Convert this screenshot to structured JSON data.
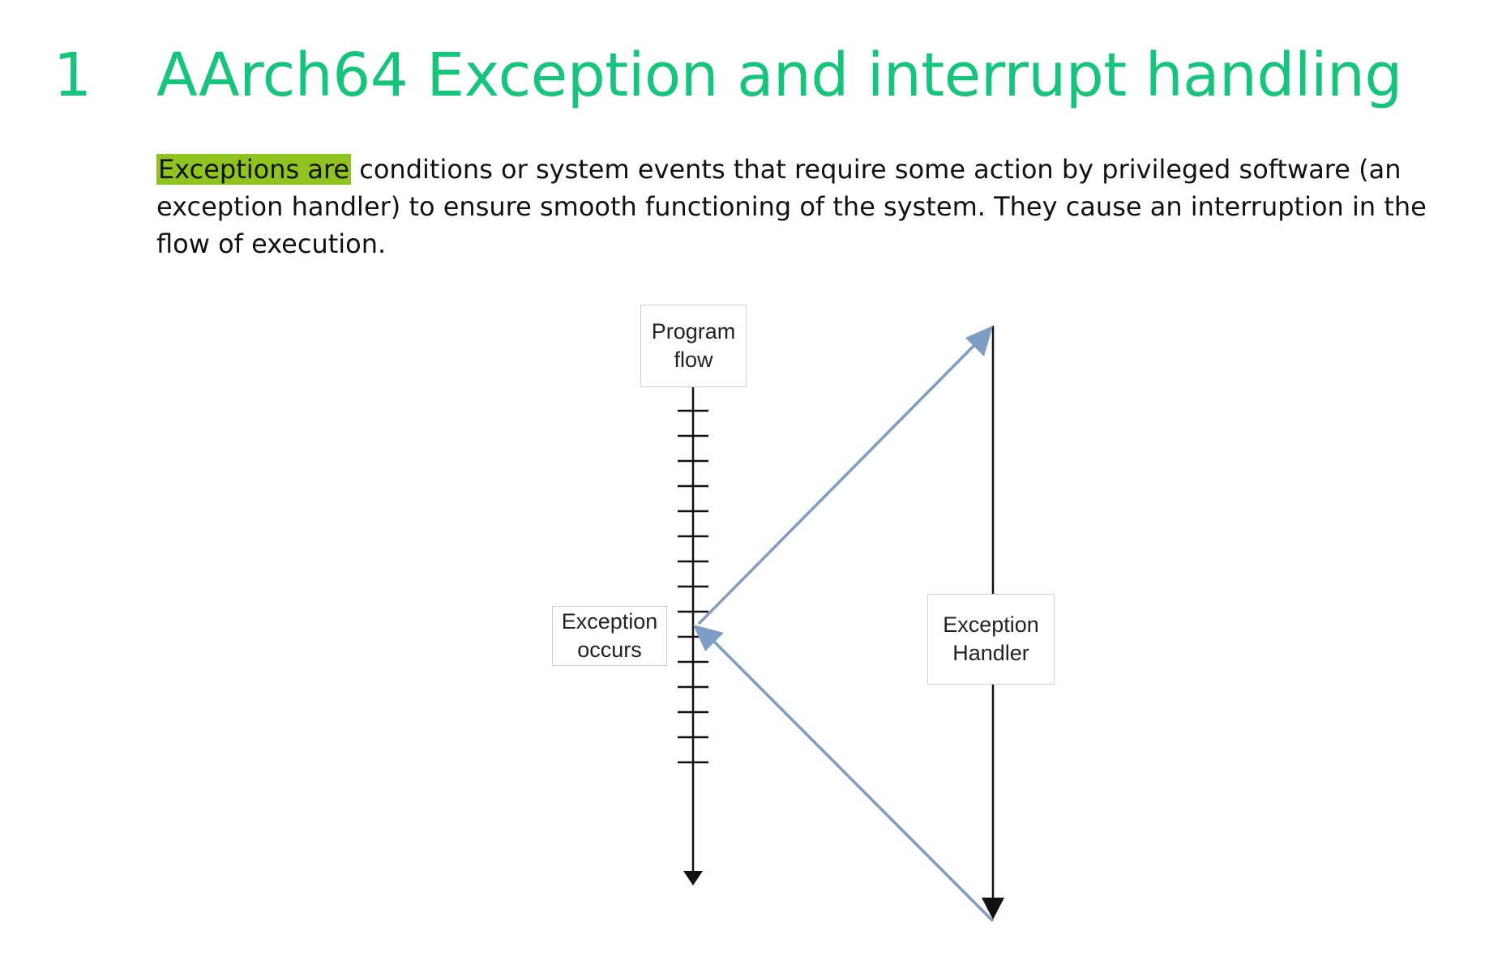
{
  "heading": {
    "number": "1",
    "title": "AArch64 Exception and interrupt handling"
  },
  "intro": {
    "highlighted": "Exceptions are",
    "rest": " conditions or system events that require some action by privileged software (an exception handler) to ensure smooth functioning of the system. They cause an interruption in the flow of execution."
  },
  "diagram": {
    "program_flow_label": "Program\nflow",
    "exception_occurs_label": "Exception\noccurs",
    "exception_handler_label": "Exception\nHandler",
    "arrow_color": "#7f9cc2",
    "line_color": "#111111"
  }
}
